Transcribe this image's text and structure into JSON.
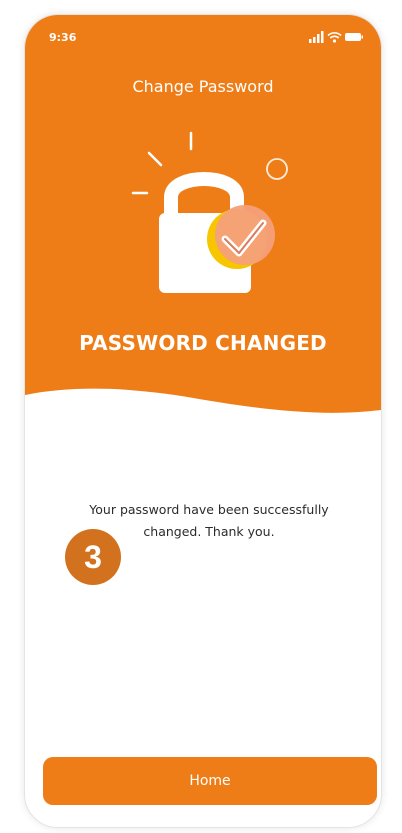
{
  "status_bar": {
    "time": "9:36",
    "icons": [
      "signal-icon",
      "wifi-icon",
      "battery-icon"
    ]
  },
  "header": {
    "title": "Change Password"
  },
  "hero": {
    "illustration": "padlock-with-checkmark",
    "heading": "PASSWORD CHANGED"
  },
  "body": {
    "message_line1": "Your password have been successfully",
    "message_line2": "changed. Thank you."
  },
  "annotation": {
    "step_number": "3"
  },
  "footer": {
    "home_label": "Home"
  },
  "colors": {
    "primary": "#ef7d17",
    "badge": "#d3721e",
    "check_yellow": "#f7c600",
    "check_peach": "#f4a07a",
    "text": "#2b2b2b"
  }
}
